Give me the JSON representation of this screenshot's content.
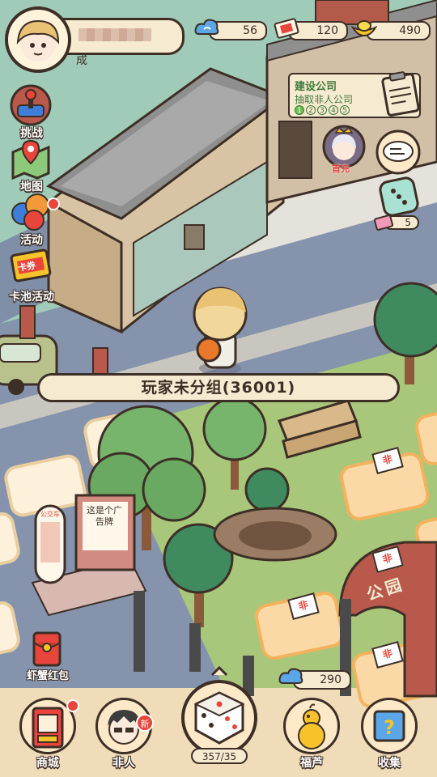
{
  "profile": {
    "name_suffix": "成"
  },
  "resources": {
    "clouds": {
      "value": "56",
      "icon": "cloud-icon"
    },
    "tickets": {
      "value": "120",
      "icon": "ticket-icon"
    },
    "gold": {
      "value": "490",
      "icon": "gold-ingot-icon"
    }
  },
  "side_menu": [
    {
      "label": "挑战",
      "icon": "joystick-icon"
    },
    {
      "label": "地图",
      "icon": "map-pin-icon"
    },
    {
      "label": "活动",
      "icon": "balloons-icon"
    },
    {
      "label": "卡池活动",
      "icon": "card-pack-icon",
      "badge": "卡券"
    }
  ],
  "quest": {
    "title": "建设公司",
    "subtitle": "抽取非人公司",
    "steps": [
      "1",
      "2",
      "3",
      "4",
      "5"
    ],
    "done_steps": 1,
    "icon": "clipboard-icon"
  },
  "event_badge": {
    "label": "首充"
  },
  "chat": {
    "icon": "chat-bubble-icon"
  },
  "mini_dice": {
    "count": "5"
  },
  "banner": {
    "text": "玩家未分组(36001)"
  },
  "board": {
    "tile_badge": "非",
    "park_sign": "公园",
    "bus_stop_sign": "公交车",
    "billboard": "这是个广告牌"
  },
  "red_packet": {
    "label": "虾蟹红包"
  },
  "cloud_counter": {
    "value": "290"
  },
  "bottom_bar": {
    "shop": {
      "label": "商城"
    },
    "feiren": {
      "label": "非人",
      "badge": "新"
    },
    "dice": {
      "count": "357/35"
    },
    "fulu": {
      "label": "福芦"
    },
    "collect": {
      "label": "收集"
    }
  },
  "colors": {
    "outline": "#3d2e26",
    "cream": "#f6ead0",
    "accent_red": "#e8453c",
    "grass": "#a9c77a"
  }
}
